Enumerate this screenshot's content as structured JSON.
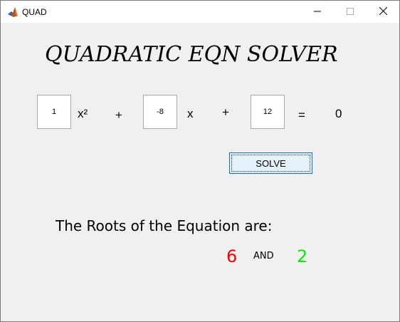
{
  "window": {
    "title": "QUAD",
    "icon": "matlab-icon",
    "controls": [
      "minimize-icon",
      "maximize-icon",
      "close-icon"
    ]
  },
  "heading": "QUADRATIC EQN SOLVER",
  "equation": {
    "a": "1",
    "x_squared": "x²",
    "plus1": "+",
    "b": "-8",
    "x": "x",
    "plus2": "+",
    "c": "12",
    "equals": "=",
    "rhs": "0"
  },
  "solve_label": "SOLVE",
  "roots": {
    "label": "The Roots of the Equation are:",
    "root1": "6",
    "and_label": "AND",
    "root2": "2",
    "root1_color": "#ff0000",
    "root2_color": "#00ee00"
  },
  "colors": {
    "background": "#f0f0f0",
    "button_bg": "#e5f1fb",
    "button_border": "#0078d7"
  }
}
